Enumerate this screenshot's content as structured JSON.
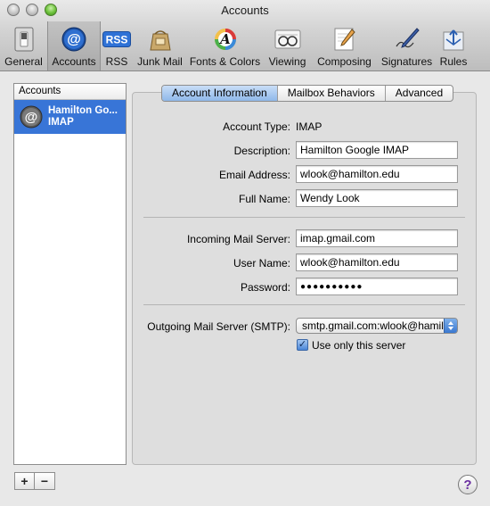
{
  "window": {
    "title": "Accounts"
  },
  "toolbar": {
    "items": [
      {
        "label": "General",
        "icon": "general-switch-icon"
      },
      {
        "label": "Accounts",
        "icon": "at-sign-icon",
        "selected": true
      },
      {
        "label": "RSS",
        "icon": "rss-icon"
      },
      {
        "label": "Junk Mail",
        "icon": "junk-mail-bag-icon"
      },
      {
        "label": "Fonts & Colors",
        "icon": "fonts-colors-icon"
      },
      {
        "label": "Viewing",
        "icon": "viewing-glasses-icon"
      },
      {
        "label": "Composing",
        "icon": "composing-pencil-icon"
      },
      {
        "label": "Signatures",
        "icon": "signature-pen-icon"
      },
      {
        "label": "Rules",
        "icon": "rules-arrows-icon"
      }
    ]
  },
  "accounts": {
    "header": "Accounts",
    "items": [
      {
        "name": "Hamilton Go...",
        "type": "IMAP",
        "selected": true
      }
    ],
    "add_label": "+",
    "remove_label": "−"
  },
  "tabs": [
    {
      "label": "Account Information",
      "active": true
    },
    {
      "label": "Mailbox Behaviors",
      "active": false
    },
    {
      "label": "Advanced",
      "active": false
    }
  ],
  "form": {
    "account_type_label": "Account Type:",
    "account_type_value": "IMAP",
    "description_label": "Description:",
    "description_value": "Hamilton Google IMAP",
    "email_label": "Email Address:",
    "email_value": "wlook@hamilton.edu",
    "fullname_label": "Full Name:",
    "fullname_value": "Wendy Look",
    "incoming_label": "Incoming Mail Server:",
    "incoming_value": "imap.gmail.com",
    "username_label": "User Name:",
    "username_value": "wlook@hamilton.edu",
    "password_label": "Password:",
    "password_value": "●●●●●●●●●●",
    "outgoing_label": "Outgoing Mail Server (SMTP):",
    "outgoing_value": "smtp.gmail.com:wlook@hamilton.edu",
    "use_only_label": "Use only this server",
    "use_only_checked": true,
    "check_mark": "✓"
  },
  "help": {
    "label": "?"
  },
  "colors": {
    "selection": "#3875d7",
    "active_tab": "#8fb8ea",
    "help_glyph": "#6a2fa0"
  }
}
